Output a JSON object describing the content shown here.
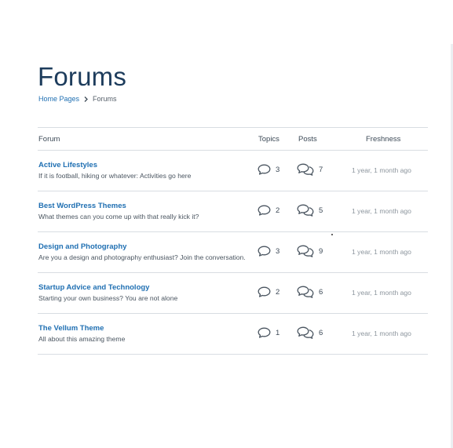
{
  "page": {
    "title": "Forums"
  },
  "breadcrumb": {
    "home": "Home Pages",
    "current": "Forums"
  },
  "table": {
    "headers": {
      "forum": "Forum",
      "topics": "Topics",
      "posts": "Posts",
      "freshness": "Freshness"
    },
    "rows": [
      {
        "title": "Active Lifestyles",
        "description": "If it is football, hiking or whatever: Activities go here",
        "topics": "3",
        "posts": "7",
        "freshness": "1 year, 1 month ago"
      },
      {
        "title": "Best WordPress Themes",
        "description": "What themes can you come up with that really kick it?",
        "topics": "2",
        "posts": "5",
        "freshness": "1 year, 1 month ago"
      },
      {
        "title": "Design and Photography",
        "description": "Are you a design and photography enthusiast? Join the conversation.",
        "topics": "3",
        "posts": "9",
        "freshness": "1 year, 1 month ago"
      },
      {
        "title": "Startup Advice and Technology",
        "description": "Starting your own business? You are not alone",
        "topics": "2",
        "posts": "6",
        "freshness": "1 year, 1 month ago"
      },
      {
        "title": "The Vellum Theme",
        "description": "All about this amazing theme",
        "topics": "1",
        "posts": "6",
        "freshness": "1 year, 1 month ago"
      }
    ]
  },
  "icons": {
    "topics": "speech-bubble-icon",
    "posts": "double-speech-bubble-icon",
    "separator": "chevron-right-icon"
  },
  "colors": {
    "title": "#1d3c5c",
    "link": "#1f6fb2",
    "icon": "#4a5560",
    "muted": "#8d969e",
    "divider": "#d8dde2"
  }
}
